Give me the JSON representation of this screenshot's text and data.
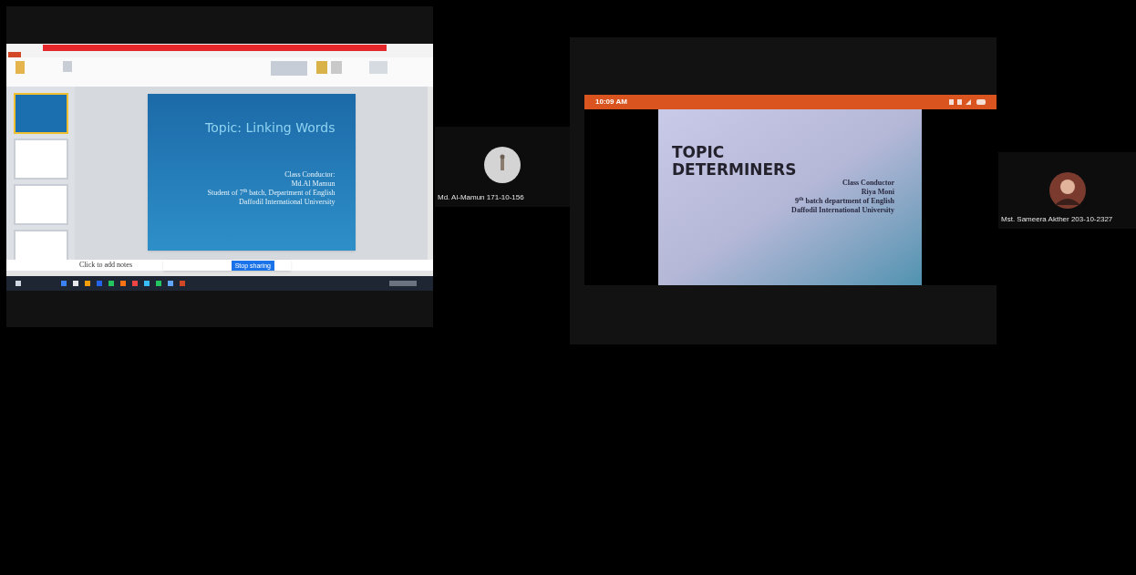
{
  "tiles": [
    {
      "kind": "screen",
      "slides": [
        {
          "selected": true
        },
        {
          "selected": false
        },
        {
          "selected": false
        },
        {
          "selected": false
        }
      ],
      "slide": {
        "title": "Topic: Linking Words",
        "lines": [
          "Class Conductor:",
          "Md.Al Mamun",
          "Student of 7$^{th}$ batch, Department of English",
          "Daffodil International University"
        ]
      },
      "notes_placeholder": "Click to add notes",
      "share_button": "Stop sharing"
    },
    {
      "kind": "participant",
      "name": "Md. Al-Mamun 171-10-156"
    },
    {
      "kind": "phone",
      "time": "10:09 AM",
      "slide": {
        "title": "TOPIC DETERMINERS",
        "lines": [
          "Class Conductor",
          "Riya Moni",
          "9$^{th}$ batch department of English",
          "Daffodil International University"
        ]
      }
    },
    {
      "kind": "participant",
      "name": "Mst. Sameera Akther 203-10-2327"
    }
  ]
}
